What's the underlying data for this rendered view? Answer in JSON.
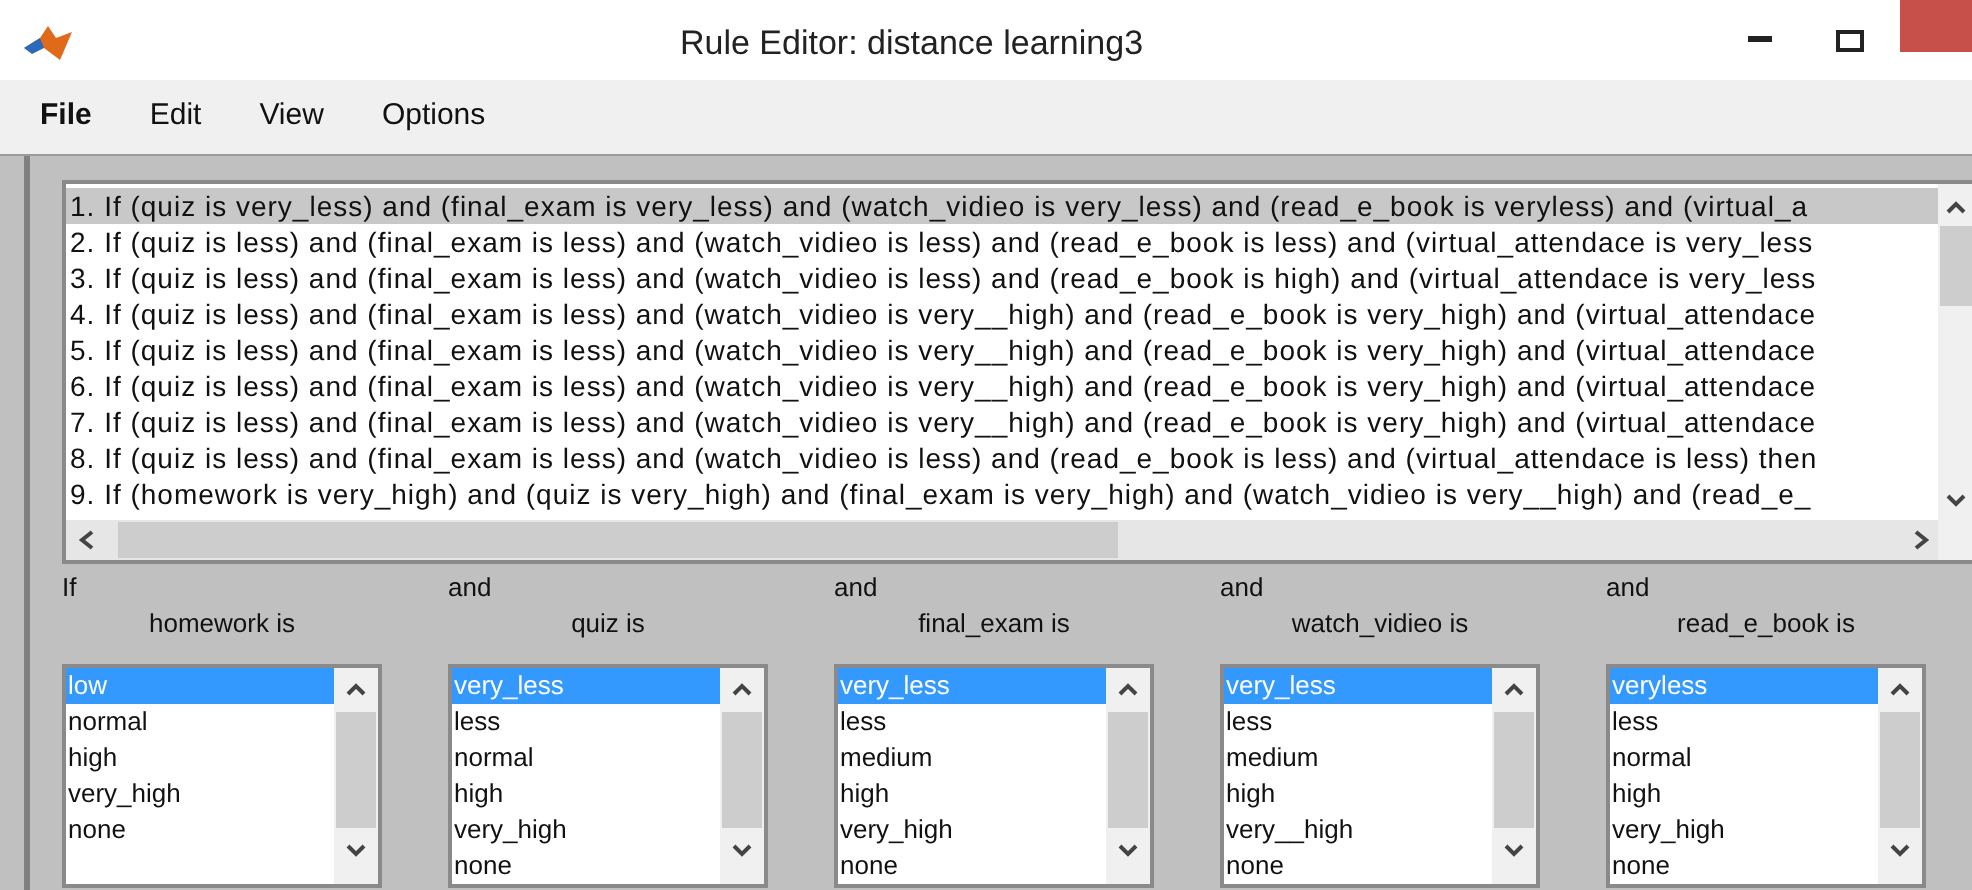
{
  "window": {
    "title": "Rule Editor: distance learning3"
  },
  "menu": [
    "File",
    "Edit",
    "View",
    "Options"
  ],
  "rules": [
    {
      "text": "1. If (quiz is very_less) and (final_exam is very_less) and (watch_vidieo is very_less) and (read_e_book is veryless) and (virtual_a",
      "selected": true
    },
    {
      "text": "2. If (quiz is less) and (final_exam is less) and (watch_vidieo is less) and (read_e_book is less) and (virtual_attendace is very_less",
      "selected": false
    },
    {
      "text": "3. If (quiz is less) and (final_exam is less) and (watch_vidieo is less) and (read_e_book is high) and (virtual_attendace is very_less",
      "selected": false
    },
    {
      "text": "4. If (quiz is less) and (final_exam is less) and (watch_vidieo is very__high) and (read_e_book is very_high) and (virtual_attendace",
      "selected": false
    },
    {
      "text": "5. If (quiz is less) and (final_exam is less) and (watch_vidieo is very__high) and (read_e_book is very_high) and (virtual_attendace",
      "selected": false
    },
    {
      "text": "6. If (quiz is less) and (final_exam is less) and (watch_vidieo is very__high) and (read_e_book is very_high) and (virtual_attendace",
      "selected": false
    },
    {
      "text": "7. If (quiz is less) and (final_exam is less) and (watch_vidieo is very__high) and (read_e_book is very_high) and (virtual_attendace",
      "selected": false
    },
    {
      "text": "8. If (quiz is less) and (final_exam is less) and (watch_vidieo is less) and (read_e_book is less) and (virtual_attendace is less) then",
      "selected": false
    },
    {
      "text": "9. If (homework is very_high) and (quiz is very_high) and (final_exam is very_high) and (watch_vidieo is very__high) and (read_e_",
      "selected": false
    }
  ],
  "inputs": [
    {
      "connector": "If",
      "label": "homework is",
      "options": [
        {
          "text": "low",
          "selected": true
        },
        {
          "text": "normal",
          "selected": false
        },
        {
          "text": "high",
          "selected": false
        },
        {
          "text": "very_high",
          "selected": false
        },
        {
          "text": "none",
          "selected": false
        }
      ]
    },
    {
      "connector": "and",
      "label": "quiz is",
      "options": [
        {
          "text": "very_less",
          "selected": true
        },
        {
          "text": "less",
          "selected": false
        },
        {
          "text": "normal",
          "selected": false
        },
        {
          "text": "high",
          "selected": false
        },
        {
          "text": "very_high",
          "selected": false
        },
        {
          "text": "none",
          "selected": false
        }
      ]
    },
    {
      "connector": "and",
      "label": "final_exam is",
      "options": [
        {
          "text": "very_less",
          "selected": true
        },
        {
          "text": "less",
          "selected": false
        },
        {
          "text": "medium",
          "selected": false
        },
        {
          "text": "high",
          "selected": false
        },
        {
          "text": "very_high",
          "selected": false
        },
        {
          "text": "none",
          "selected": false
        }
      ]
    },
    {
      "connector": "and",
      "label": "watch_vidieo is",
      "options": [
        {
          "text": "very_less",
          "selected": true
        },
        {
          "text": "less",
          "selected": false
        },
        {
          "text": "medium",
          "selected": false
        },
        {
          "text": "high",
          "selected": false
        },
        {
          "text": "very__high",
          "selected": false
        },
        {
          "text": "none",
          "selected": false
        }
      ]
    },
    {
      "connector": "and",
      "label": "read_e_book is",
      "options": [
        {
          "text": "veryless",
          "selected": true
        },
        {
          "text": "less",
          "selected": false
        },
        {
          "text": "normal",
          "selected": false
        },
        {
          "text": "high",
          "selected": false
        },
        {
          "text": "very_high",
          "selected": false
        },
        {
          "text": "none",
          "selected": false
        }
      ]
    }
  ]
}
